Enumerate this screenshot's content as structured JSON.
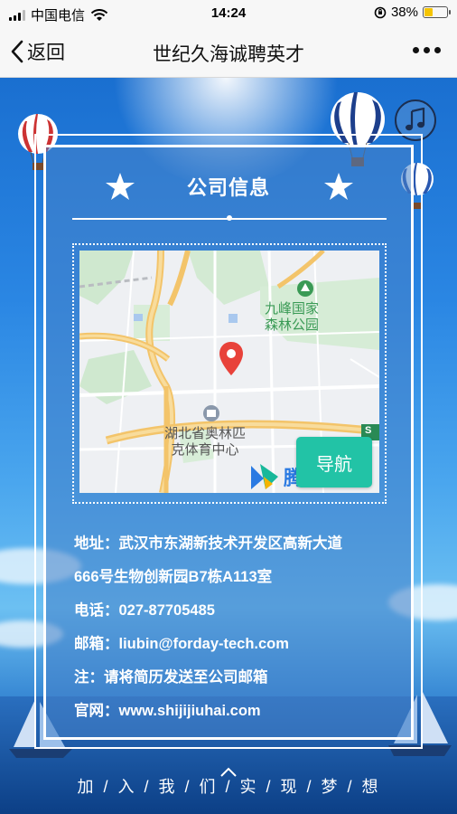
{
  "status_bar": {
    "carrier": "中国电信",
    "time": "14:24",
    "battery_percent": "38%",
    "battery_level": 0.38
  },
  "nav": {
    "back_label": "返回",
    "title": "世纪久海诚聘英才"
  },
  "panel": {
    "section_title": "公司信息",
    "map": {
      "poi_park_line1": "九峰国家",
      "poi_park_line2": "森林公园",
      "poi_stadium_line1": "湖北省奥林匹",
      "poi_stadium_line2": "克体育中心",
      "road_sign": "S",
      "logo_text": "腾",
      "navigate_label": "导航"
    },
    "info": {
      "address_line1": "地址：武汉市东湖新技术开发区高新大道",
      "address_line2": "666号生物创新园B7栋A113室",
      "phone": "电话：027-87705485",
      "email": "邮箱：liubin@forday-tech.com",
      "note": "注：请将简历发送至公司邮箱",
      "website": "官网：www.shijijiuhai.com"
    }
  },
  "footer": {
    "slogan": "加 / 入 / 我 / 们 / 实 / 现 / 梦 / 想"
  },
  "icons": {
    "music": "music-note-icon",
    "back": "chevron-left-icon",
    "more": "more-dots-icon",
    "pin": "map-pin-icon"
  },
  "colors": {
    "navigate_button": "#22c3a6",
    "pin": "#e8423a",
    "battery": "#f5c400"
  }
}
